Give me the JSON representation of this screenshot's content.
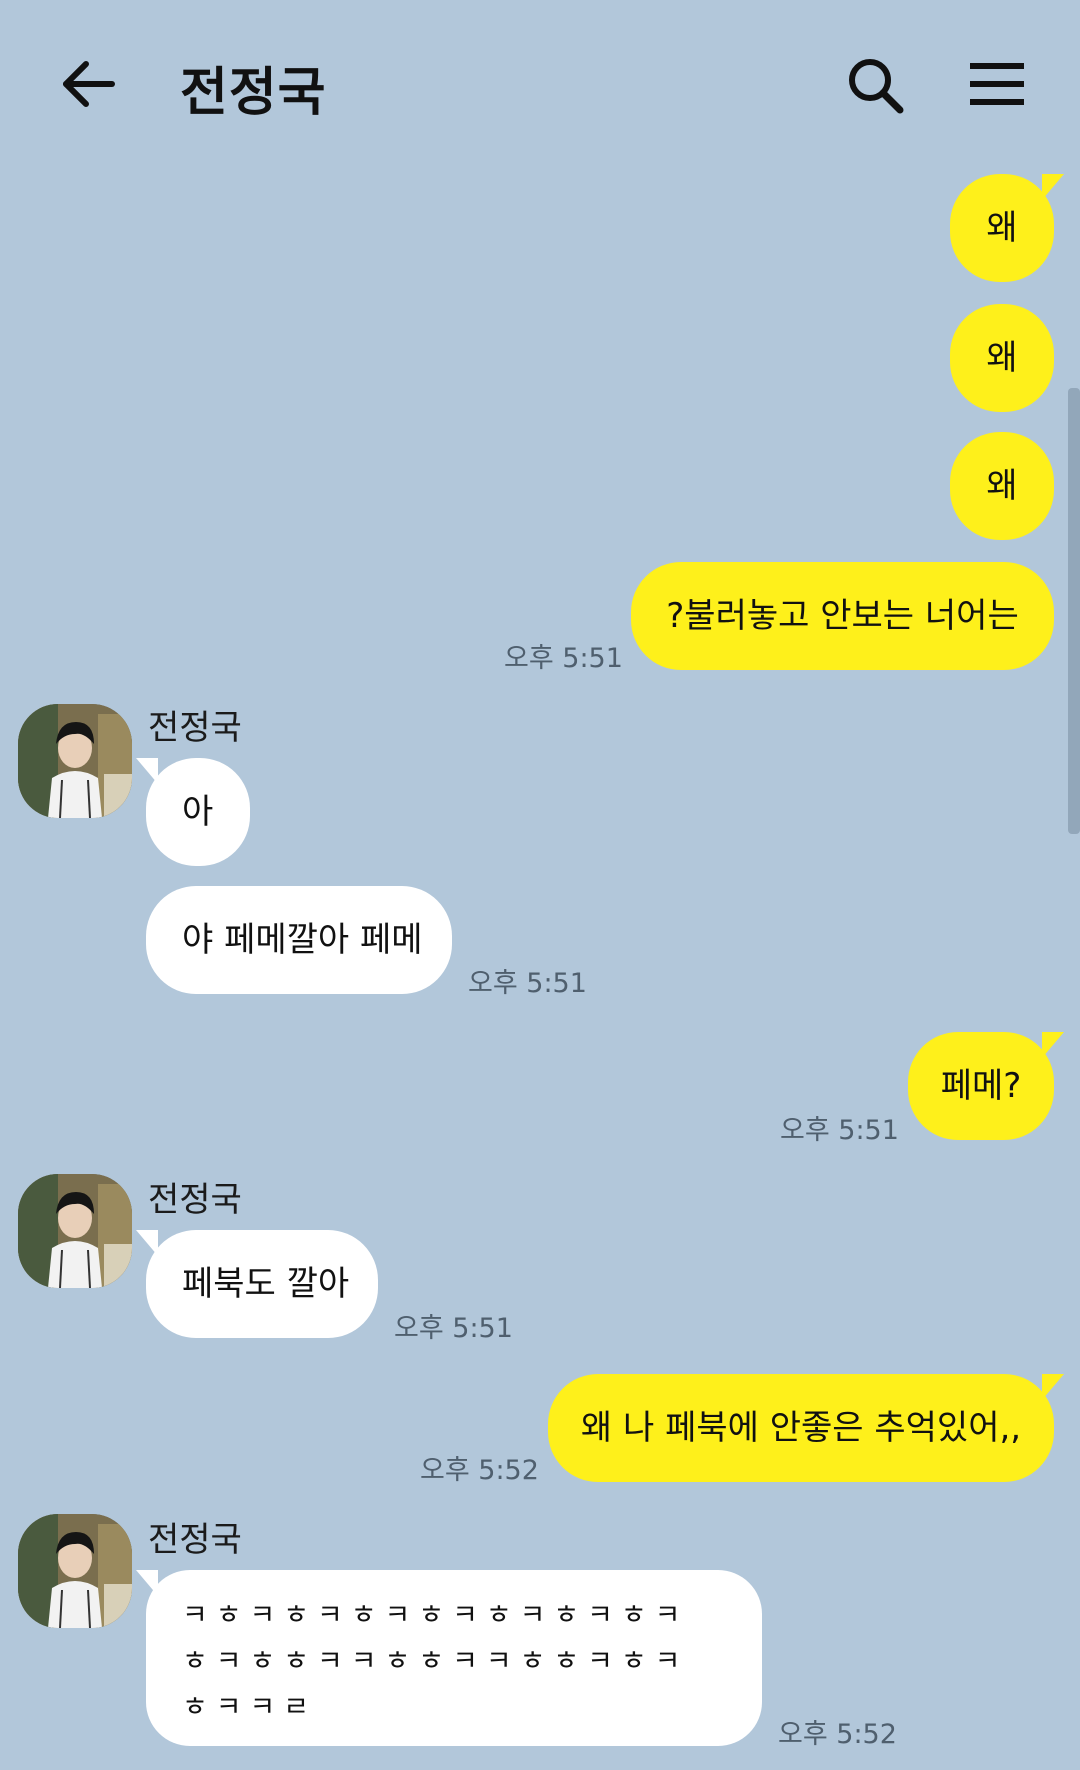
{
  "header": {
    "title": "전정국"
  },
  "messages": {
    "m1": "왜",
    "m2": "왜",
    "m3": "왜",
    "m4": "?불러놓고 안보는 너어는",
    "m4_time": "오후 5:51",
    "sender": "전정국",
    "m5": "아",
    "m6": "야 페메깔아 페메",
    "m6_time": "오후 5:51",
    "m7": "페메?",
    "m7_time": "오후 5:51",
    "m8": "페북도 깔아",
    "m8_time": "오후 5:51",
    "m9": "왜 나 페북에 안좋은 추억있어,,",
    "m9_time": "오후 5:52",
    "m10_line1": "ㅋㅎㅋㅎㅋㅎㅋㅎㅋㅎㅋㅎㅋㅎㅋ",
    "m10_line2": "ㅎㅋㅎㅎㅋㅋㅎㅎㅋㅋㅎㅎㅋㅎㅋ",
    "m10_line3": "ㅎㅋㅋㄹ",
    "m10_time": "오후 5:52"
  }
}
